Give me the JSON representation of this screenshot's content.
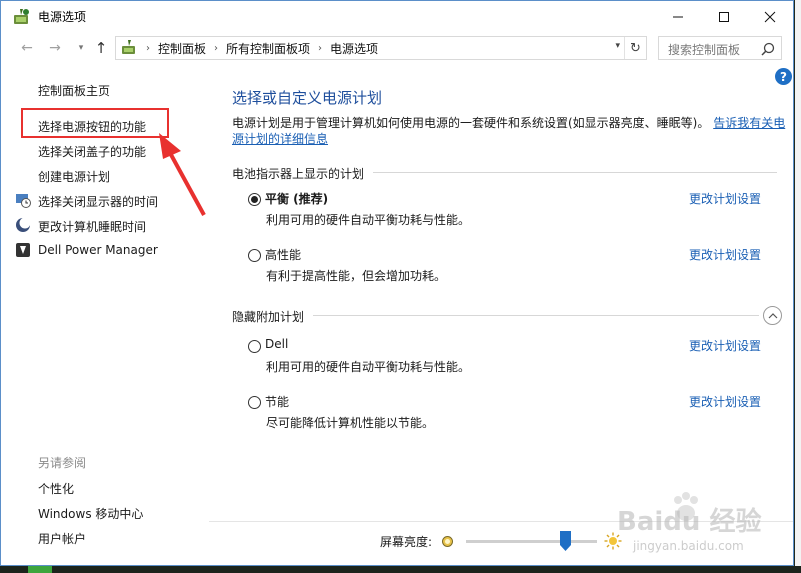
{
  "window": {
    "title": "电源选项",
    "controls": {
      "minimize": "—",
      "maximize": "☐",
      "close": "✕"
    }
  },
  "address_bar": {
    "breadcrumbs": [
      "控制面板",
      "所有控制面板项",
      "电源选项"
    ],
    "search_placeholder": "搜索控制面板"
  },
  "sidebar": {
    "home_link": "控制面板主页",
    "links": [
      {
        "label": "选择电源按钮的功能",
        "icon": "none",
        "highlighted": true
      },
      {
        "label": "选择关闭盖子的功能",
        "icon": "none"
      },
      {
        "label": "创建电源计划",
        "icon": "none"
      },
      {
        "label": "选择关闭显示器的时间",
        "icon": "display-clock-icon"
      },
      {
        "label": "更改计算机睡眠时间",
        "icon": "moon-icon"
      },
      {
        "label": "Dell Power Manager",
        "icon": "dell-app-icon"
      }
    ],
    "see_also": {
      "heading": "另请参阅",
      "links": [
        "个性化",
        "Windows 移动中心",
        "用户帐户"
      ]
    }
  },
  "main": {
    "title": "选择或自定义电源计划",
    "description_line1": "电源计划是用于管理计算机如何使用电源的一套硬件和系统设置(如显示器亮度、睡眠等)。",
    "description_link": "告诉我有关电源计划的详细信息",
    "battery_section": {
      "heading": "电池指示器上显示的计划",
      "plans": [
        {
          "name": "平衡 (推荐)",
          "description": "利用可用的硬件自动平衡功耗与性能。",
          "selected": true,
          "link": "更改计划设置"
        },
        {
          "name": "高性能",
          "description": "有利于提高性能，但会增加功耗。",
          "selected": false,
          "link": "更改计划设置"
        }
      ]
    },
    "hidden_section": {
      "heading": "隐藏附加计划",
      "plans": [
        {
          "name": "Dell",
          "description": "利用可用的硬件自动平衡功耗与性能。",
          "selected": false,
          "link": "更改计划设置"
        },
        {
          "name": "节能",
          "description": "尽可能降低计算机性能以节能。",
          "selected": false,
          "link": "更改计划设置"
        }
      ]
    }
  },
  "brightness": {
    "label": "屏幕亮度:",
    "level": 0.76
  },
  "watermark": {
    "text": "Baidu 经验",
    "sub": "jingyan.baidu.com"
  },
  "colors": {
    "link": "#1a5fb4",
    "title": "#1e4e9c",
    "highlight_box": "#e8312f",
    "annotation_arrow": "#e8312f"
  }
}
